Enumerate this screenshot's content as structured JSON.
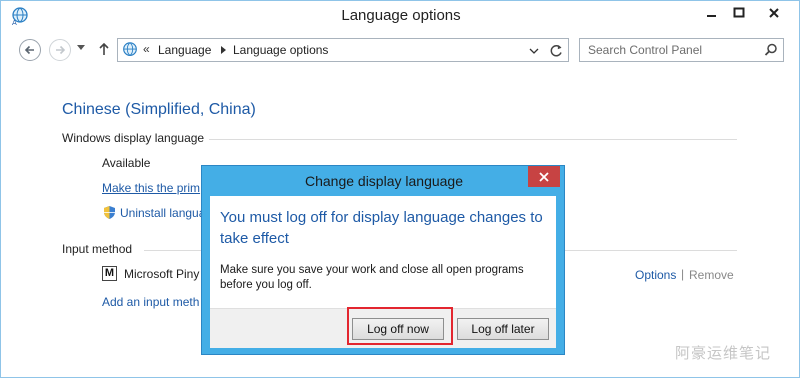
{
  "window": {
    "title": "Language options",
    "icon": "language-globe-icon"
  },
  "navigation": {
    "address_chevron": "«",
    "breadcrumbs": [
      "Language",
      "Language options"
    ],
    "search_placeholder": "Search Control Panel"
  },
  "content": {
    "language_name": "Chinese (Simplified, China)",
    "display_language_section": "Windows display language",
    "availability": "Available",
    "make_primary_link": "Make this the prim",
    "uninstall_link": "Uninstall langua",
    "input_method_section": "Input method",
    "input_method_icon_letter": "M",
    "input_method_name": "Microsoft Piny",
    "add_input_method_link": "Add an input meth",
    "options_link": "Options",
    "separator": "|",
    "remove_link": "Remove"
  },
  "dialog": {
    "title": "Change display language",
    "heading": "You must log off for display language changes to take effect",
    "message": "Make sure you save your work and close all open programs before you log off.",
    "log_off_now_label": "Log off now",
    "log_off_later_label": "Log off later"
  },
  "watermark": "阿豪运维笔记",
  "colors": {
    "accent_blue": "#1e5aa6",
    "dialog_frame": "#44aee6",
    "close_red": "#c74343",
    "highlight_red": "#e3262f"
  }
}
